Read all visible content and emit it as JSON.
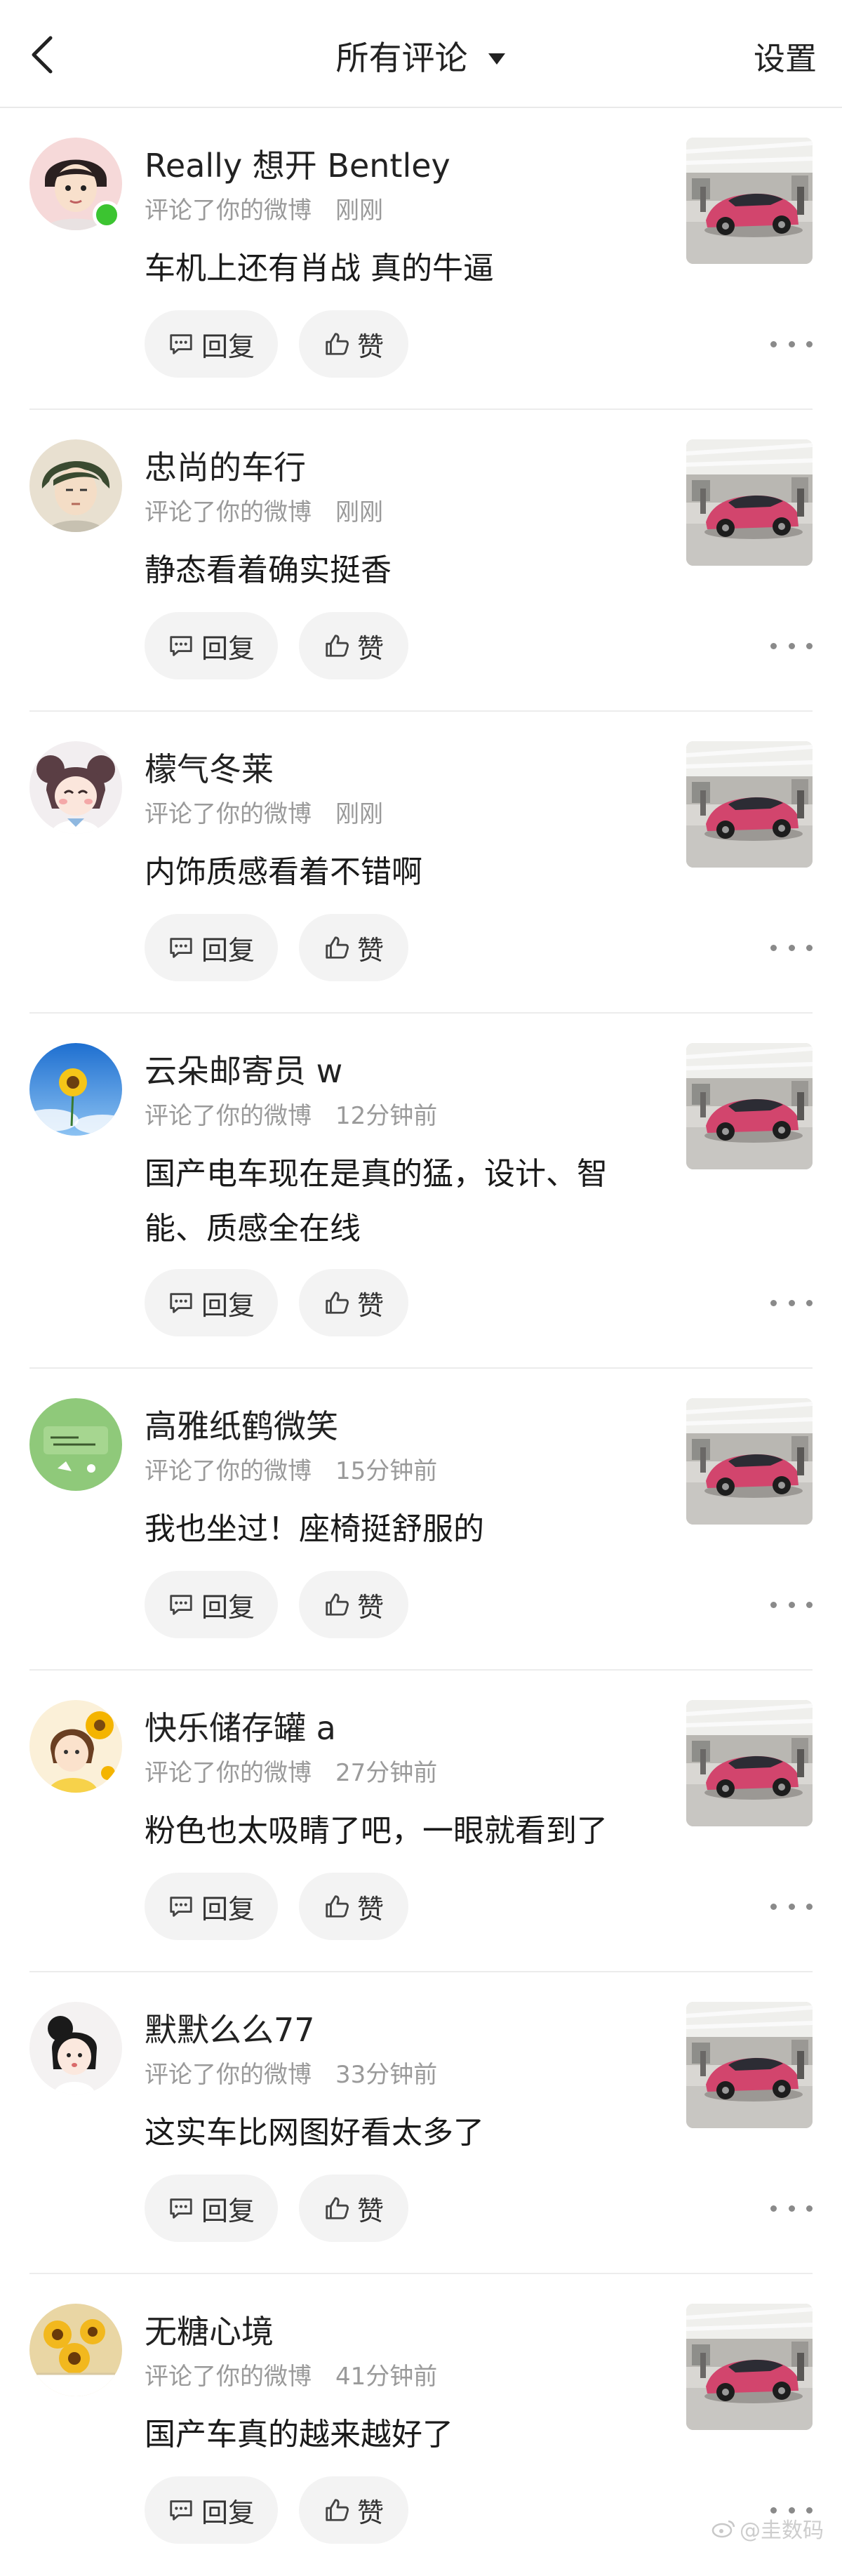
{
  "header": {
    "title": "所有评论",
    "settings_label": "设置"
  },
  "common": {
    "reply_label": "回复",
    "like_label": "赞"
  },
  "comments": [
    {
      "name": "Really 想开 Bentley",
      "meta": "评论了你的微博",
      "time": "刚刚",
      "text": "车机上还有肖战 真的牛逼",
      "online": true
    },
    {
      "name": "忠尚的车行",
      "meta": "评论了你的微博",
      "time": "刚刚",
      "text": "静态看着确实挺香"
    },
    {
      "name": "檬气冬莱",
      "meta": "评论了你的微博",
      "time": "刚刚",
      "text": "内饰质感看着不错啊"
    },
    {
      "name": "云朵邮寄员 w",
      "meta": "评论了你的微博",
      "time": "12分钟前",
      "text": "国产电车现在是真的猛，设计、智能、质感全在线"
    },
    {
      "name": "高雅纸鹤微笑",
      "meta": "评论了你的微博",
      "time": "15分钟前",
      "text": "我也坐过！座椅挺舒服的"
    },
    {
      "name": "快乐储存罐 a",
      "meta": "评论了你的微博",
      "time": "27分钟前",
      "text": "粉色也太吸睛了吧，一眼就看到了"
    },
    {
      "name": "默默么么77",
      "meta": "评论了你的微博",
      "time": "33分钟前",
      "text": "这实车比网图好看太多了"
    },
    {
      "name": "无糖心境",
      "meta": "评论了你的微博",
      "time": "41分钟前",
      "text": "国产车真的越来越好了"
    }
  ],
  "watermark": "@圭数码",
  "icons": {
    "back": "chevron-left-icon",
    "dropdown": "caret-down-icon",
    "reply": "comment-icon",
    "like": "thumbs-up-icon",
    "more": "more-dots-icon"
  },
  "colors": {
    "online": "#3cc431",
    "pill_bg": "#f3f3f3",
    "meta_text": "#9a9a9a",
    "car": "#d2456d"
  }
}
